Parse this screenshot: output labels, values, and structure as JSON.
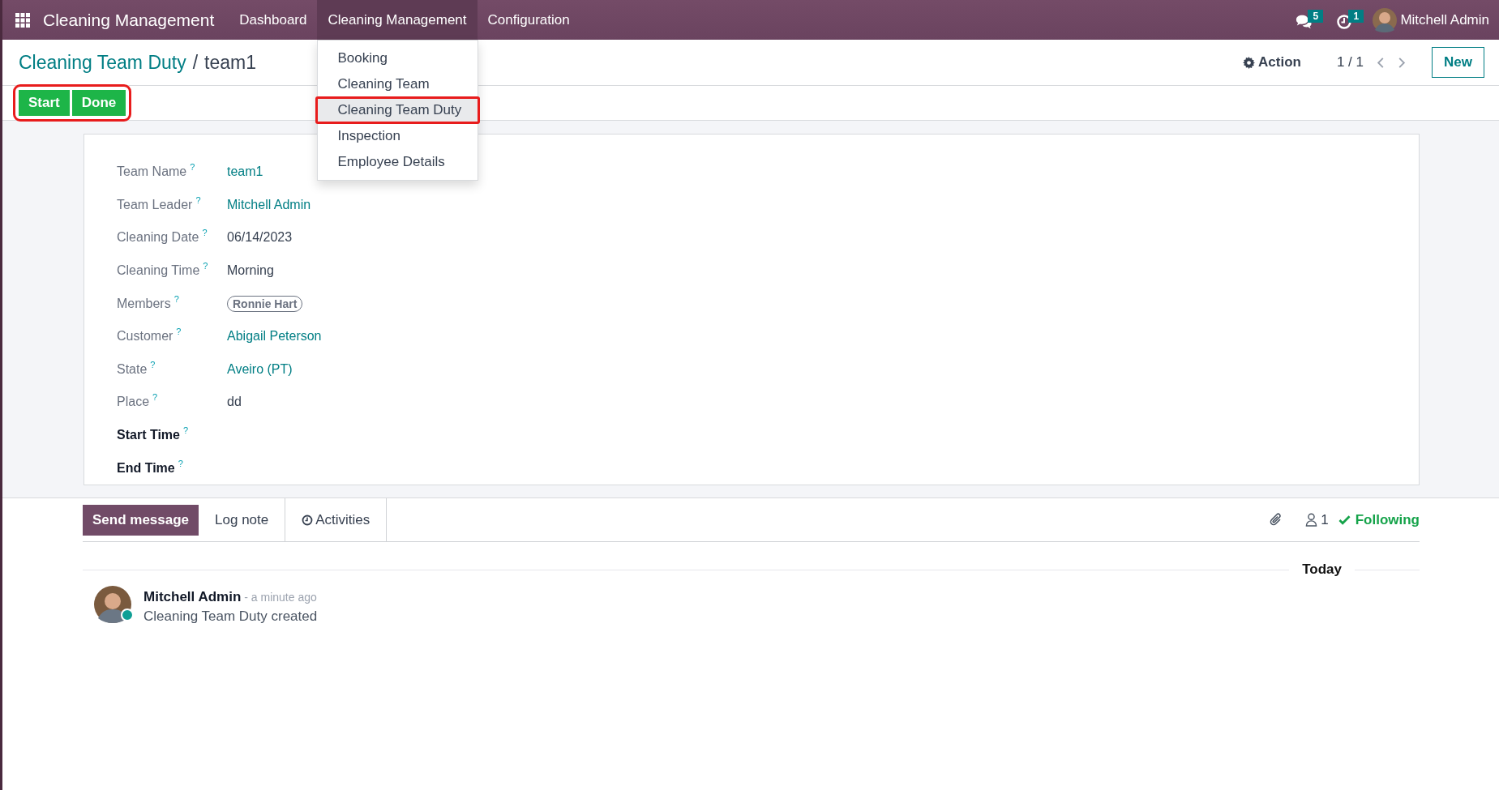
{
  "navbar": {
    "app_name": "Cleaning Management",
    "menus": [
      {
        "label": "Dashboard",
        "selected": false
      },
      {
        "label": "Cleaning Management",
        "selected": true
      },
      {
        "label": "Configuration",
        "selected": false
      }
    ],
    "messages_badge": "5",
    "activities_badge": "1",
    "user": "Mitchell Admin"
  },
  "dropdown": {
    "items": [
      {
        "label": "Booking",
        "selected": false,
        "highlighted": false
      },
      {
        "label": "Cleaning Team",
        "selected": false,
        "highlighted": false
      },
      {
        "label": "Cleaning Team Duty",
        "selected": true,
        "highlighted": true
      },
      {
        "label": "Inspection",
        "selected": false,
        "highlighted": false
      },
      {
        "label": "Employee Details",
        "selected": false,
        "highlighted": false
      }
    ]
  },
  "breadcrumb": {
    "parent": "Cleaning Team Duty",
    "separator": "/",
    "current": "team1"
  },
  "control_panel": {
    "action": "Action",
    "pager": "1 / 1",
    "new_button": "New"
  },
  "status_buttons": {
    "highlighted": true,
    "buttons": [
      "Start",
      "Done"
    ]
  },
  "form": {
    "fields": [
      {
        "label": "Team Name",
        "required": false,
        "kind": "link",
        "value": "team1"
      },
      {
        "label": "Team Leader",
        "required": false,
        "kind": "link",
        "value": "Mitchell Admin"
      },
      {
        "label": "Cleaning Date",
        "required": false,
        "kind": "text",
        "value": "06/14/2023"
      },
      {
        "label": "Cleaning Time",
        "required": false,
        "kind": "text",
        "value": "Morning"
      },
      {
        "label": "Members",
        "required": false,
        "kind": "tag",
        "value": "Ronnie Hart"
      },
      {
        "label": "Customer",
        "required": false,
        "kind": "link",
        "value": "Abigail Peterson"
      },
      {
        "label": "State",
        "required": false,
        "kind": "link",
        "value": "Aveiro (PT)"
      },
      {
        "label": "Place",
        "required": false,
        "kind": "text",
        "value": "dd"
      },
      {
        "label": "Start Time",
        "required": true,
        "kind": "empty"
      },
      {
        "label": "End Time",
        "required": true,
        "kind": "empty"
      }
    ],
    "help_mark": "?"
  },
  "chatter": {
    "tabs": [
      {
        "label": "Send message",
        "selected": true
      },
      {
        "label": "Log note",
        "selected": false
      },
      {
        "label": "Activities",
        "selected": false
      }
    ],
    "followers": "1",
    "following": "Following",
    "date_separator": "Today",
    "messages": [
      {
        "author": "Mitchell Admin",
        "time": "- a minute ago",
        "body": "Cleaning Team Duty created"
      }
    ]
  }
}
